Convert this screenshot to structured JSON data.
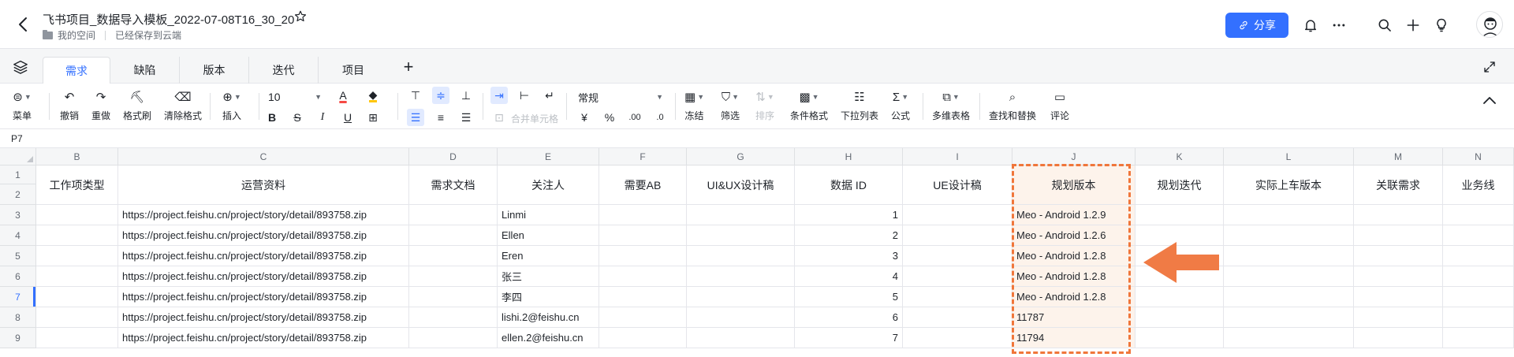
{
  "header": {
    "title": "飞书项目_数据导入模板_2022-07-08T16_30_20",
    "breadcrumb_space": "我的空间",
    "save_status": "已经保存到云端",
    "share_label": "分享"
  },
  "tabs": [
    {
      "label": "需求"
    },
    {
      "label": "缺陷"
    },
    {
      "label": "版本"
    },
    {
      "label": "迭代"
    },
    {
      "label": "项目"
    }
  ],
  "toolbar": {
    "menu": "菜单",
    "undo": "撤销",
    "redo": "重做",
    "format_painter": "格式刷",
    "clear_format": "清除格式",
    "insert": "插入",
    "font_size": "10",
    "merge_cells": "合并单元格",
    "number_format": "常规",
    "freeze": "冻结",
    "filter": "筛选",
    "sort": "排序",
    "conditional_format": "条件格式",
    "dropdown_list": "下拉列表",
    "formula": "公式",
    "multi_table": "多维表格",
    "find_replace": "查找和替换",
    "comment": "评论",
    "currency": "¥",
    "percent": "%"
  },
  "formula_bar": {
    "cell_ref": "P7"
  },
  "grid": {
    "col_letters": [
      "B",
      "C",
      "D",
      "E",
      "F",
      "G",
      "H",
      "I",
      "J",
      "K",
      "L",
      "M",
      "N"
    ],
    "header_labels": [
      "工作项类型",
      "运营资料",
      "需求文档",
      "关注人",
      "需要AB",
      "UI&UX设计稿",
      "数据 ID",
      "UE设计稿",
      "规划版本",
      "规划迭代",
      "实际上车版本",
      "关联需求",
      "业务线"
    ],
    "row_numbers": [
      "1",
      "2",
      "3",
      "4",
      "5",
      "6",
      "7",
      "8",
      "9"
    ],
    "selected_row": "7",
    "rows": [
      {
        "c": "https://project.feishu.cn/project/story/detail/893758.zip",
        "e": "Linmi",
        "h": "1",
        "j": "Meo - Android 1.2.9"
      },
      {
        "c": "https://project.feishu.cn/project/story/detail/893758.zip",
        "e": "Ellen",
        "h": "2",
        "j": "Meo - Android 1.2.6"
      },
      {
        "c": "https://project.feishu.cn/project/story/detail/893758.zip",
        "e": "Eren",
        "h": "3",
        "j": "Meo - Android 1.2.8"
      },
      {
        "c": "https://project.feishu.cn/project/story/detail/893758.zip",
        "e": "张三",
        "h": "4",
        "j": "Meo - Android 1.2.8"
      },
      {
        "c": "https://project.feishu.cn/project/story/detail/893758.zip",
        "e": "李四",
        "h": "5",
        "j": "Meo - Android 1.2.8"
      },
      {
        "c": "https://project.feishu.cn/project/story/detail/893758.zip",
        "e": "lishi.2@feishu.cn",
        "h": "6",
        "j": "11787"
      },
      {
        "c": "https://project.feishu.cn/project/story/detail/893758.zip",
        "e": "ellen.2@feishu.cn",
        "h": "7",
        "j": "11794"
      }
    ]
  },
  "colors": {
    "accent": "#3370ff",
    "highlight_border": "#f0763a",
    "highlight_fill": "#fdf3eb",
    "arrow": "#f07b45"
  },
  "icons": [
    "back-icon",
    "star-icon",
    "link-icon",
    "bell-icon",
    "more-icon",
    "search-icon",
    "plus-icon",
    "bulb-icon",
    "layers-icon",
    "expand-icon",
    "collapse-icon"
  ]
}
